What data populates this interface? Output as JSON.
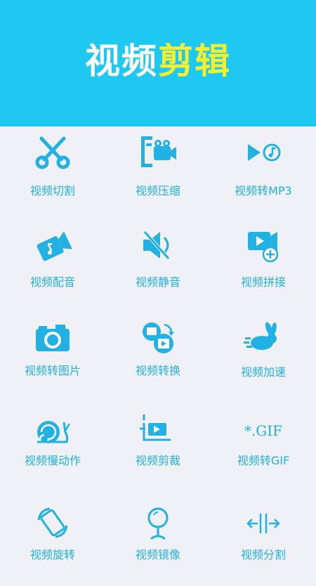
{
  "header": {
    "title_white": "视频",
    "title_yellow": "剪辑"
  },
  "colors": {
    "accent": "#1ec8f0",
    "icon": "#21b1e4",
    "title_yellow": "#f5f02e",
    "background": "#eff1f6"
  },
  "tools": [
    {
      "label": "视频切割",
      "icon": "scissors-icon"
    },
    {
      "label": "视频压缩",
      "icon": "clamp-camera-icon"
    },
    {
      "label": "视频转MP3",
      "icon": "play-music-icon"
    },
    {
      "label": "视频配音",
      "icon": "video-music-icon"
    },
    {
      "label": "视频静音",
      "icon": "mute-icon"
    },
    {
      "label": "视频拼接",
      "icon": "video-add-icon"
    },
    {
      "label": "视频转图片",
      "icon": "camera-icon"
    },
    {
      "label": "视频转换",
      "icon": "convert-icon"
    },
    {
      "label": "视频加速",
      "icon": "rabbit-icon"
    },
    {
      "label": "视频慢动作",
      "icon": "snail-icon"
    },
    {
      "label": "视频剪裁",
      "icon": "crop-icon"
    },
    {
      "label": "视频转GIF",
      "icon": "gif-icon"
    },
    {
      "label": "视频旋转",
      "icon": "rotate-icon"
    },
    {
      "label": "视频镜像",
      "icon": "mirror-icon"
    },
    {
      "label": "视频分割",
      "icon": "split-icon"
    }
  ],
  "gif_icon_text": "*.GIF"
}
